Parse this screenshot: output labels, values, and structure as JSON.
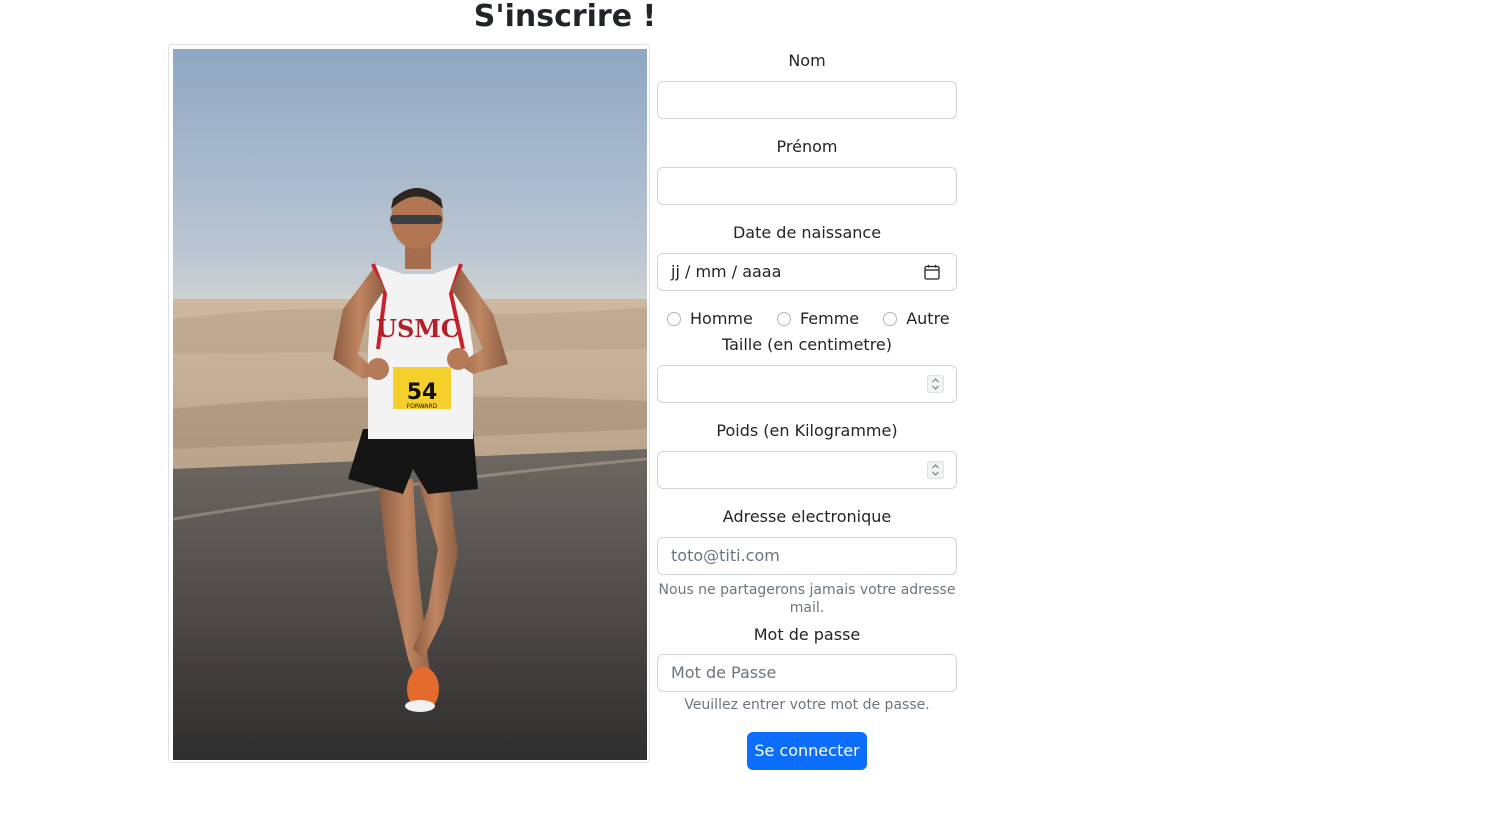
{
  "title": "S'inscrire !",
  "photo": {
    "bib_text": "USMC",
    "bib_number": "54",
    "bib_sponsor": "FORWARD"
  },
  "form": {
    "nom_label": "Nom",
    "nom_value": "",
    "prenom_label": "Prénom",
    "prenom_value": "",
    "dob_label": "Date de naissance",
    "dob_placeholder": "jj / mm / aaaa",
    "gender_options": [
      "Homme",
      "Femme",
      "Autre"
    ],
    "taille_label": "Taille (en centimetre)",
    "taille_value": "",
    "poids_label": "Poids (en Kilogramme)",
    "poids_value": "",
    "email_label": "Adresse electronique",
    "email_placeholder": "toto@titi.com",
    "email_help": "Nous ne partagerons jamais votre adresse mail.",
    "password_label": "Mot de passe",
    "password_placeholder": "Mot de Passe",
    "password_help": "Veuillez entrer votre mot de passe.",
    "submit_label": "Se connecter"
  },
  "colors": {
    "primary": "#0d6efd",
    "border": "#ced4da",
    "muted": "#6c757d"
  }
}
